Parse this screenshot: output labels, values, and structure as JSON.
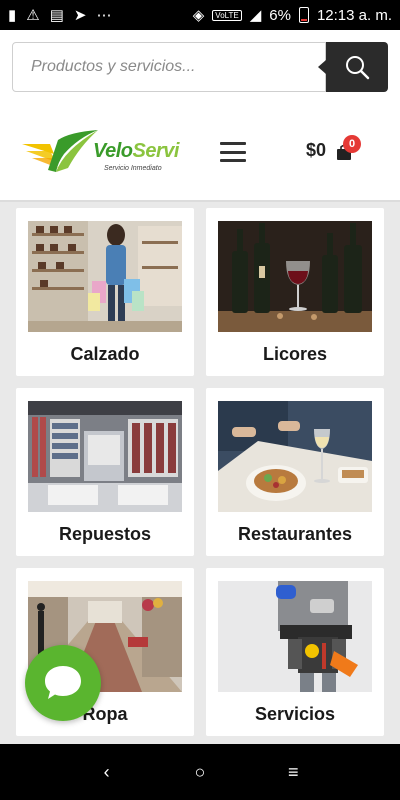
{
  "status_bar": {
    "battery": "6%",
    "time": "12:13 a. m.",
    "volte": "VoLTE"
  },
  "search": {
    "placeholder": "Productos y servicios..."
  },
  "header": {
    "logo_velo": "Velo",
    "logo_servi": "Servi",
    "logo_tagline": "Servicio Inmediato",
    "cart_amount": "$0",
    "cart_count": "0"
  },
  "categories": [
    {
      "label": "Calzado",
      "photo": "shoe-store-photo"
    },
    {
      "label": "Licores",
      "photo": "wine-bottles-photo"
    },
    {
      "label": "Repuestos",
      "photo": "parts-store-photo"
    },
    {
      "label": "Restaurantes",
      "photo": "restaurant-meal-photo"
    },
    {
      "label": "Ropa",
      "photo": "clothing-mall-photo"
    },
    {
      "label": "Servicios",
      "photo": "tool-belt-photo"
    }
  ],
  "colors": {
    "brand_green": "#5ab52f",
    "badge_red": "#e53935",
    "search_button": "#2b2b2b"
  }
}
